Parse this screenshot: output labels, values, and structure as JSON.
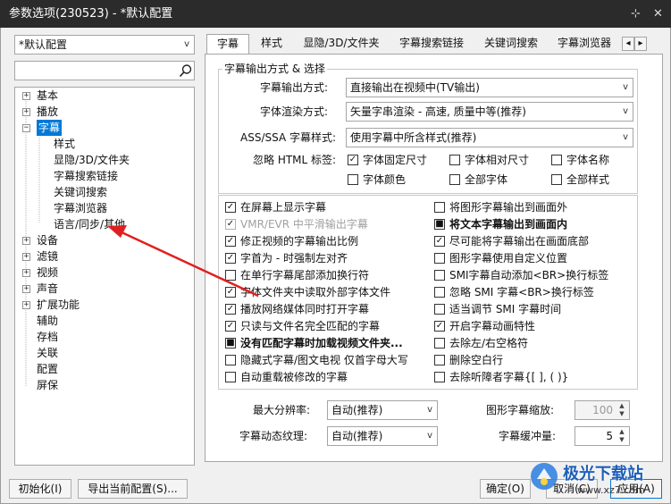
{
  "window": {
    "title": "参数选项(230523) - *默认配置",
    "pin": "⊹",
    "close": "✕"
  },
  "profile_select": {
    "value": "*默认配置"
  },
  "search": {
    "placeholder": ""
  },
  "tree": {
    "items": [
      {
        "label": "基本",
        "expander": "+"
      },
      {
        "label": "播放",
        "expander": "+"
      },
      {
        "label": "字幕",
        "expander": "−"
      },
      {
        "label": "样式"
      },
      {
        "label": "显隐/3D/文件夹"
      },
      {
        "label": "字幕搜索链接"
      },
      {
        "label": "关键词搜索"
      },
      {
        "label": "字幕浏览器"
      },
      {
        "label": "语言/同步/其他"
      },
      {
        "label": "设备",
        "expander": "+"
      },
      {
        "label": "滤镜",
        "expander": "+"
      },
      {
        "label": "视频",
        "expander": "+"
      },
      {
        "label": "声音",
        "expander": "+"
      },
      {
        "label": "扩展功能",
        "expander": "+"
      },
      {
        "label": "辅助"
      },
      {
        "label": "存档"
      },
      {
        "label": "关联"
      },
      {
        "label": "配置"
      },
      {
        "label": "屏保"
      }
    ]
  },
  "tabs": [
    {
      "label": "字幕"
    },
    {
      "label": "样式"
    },
    {
      "label": "显隐/3D/文件夹"
    },
    {
      "label": "字幕搜索链接"
    },
    {
      "label": "关键词搜索"
    },
    {
      "label": "字幕浏览器"
    }
  ],
  "tab_scroll": {
    "left": "◂",
    "right": "▸"
  },
  "output_group": {
    "title": "字幕输出方式 & 选择",
    "output_mode_label": "字幕输出方式:",
    "output_mode_value": "直接输出在视频中(TV输出)",
    "render_label": "字体渲染方式:",
    "render_value": "矢量字串渲染 - 高速, 质量中等(推荐)",
    "ass_label": "ASS/SSA 字幕样式:",
    "ass_value": "使用字幕中所含样式(推荐)",
    "html_label": "忽略 HTML 标签:",
    "html_options": [
      {
        "label": "字体固定尺寸",
        "checked": true
      },
      {
        "label": "字体相对尺寸",
        "checked": false
      },
      {
        "label": "字体名称",
        "checked": false
      },
      {
        "label": "字体颜色",
        "checked": false
      },
      {
        "label": "全部字体",
        "checked": false
      },
      {
        "label": "全部样式",
        "checked": false
      }
    ]
  },
  "options_left": [
    {
      "label": "在屏幕上显示字幕",
      "state": "checked"
    },
    {
      "label": "VMR/EVR 中平滑输出字幕",
      "state": "disabled"
    },
    {
      "label": "修正视频的字幕输出比例",
      "state": "checked"
    },
    {
      "label": "字首为 - 时强制左对齐",
      "state": "checked"
    },
    {
      "label": "在单行字幕尾部添加换行符",
      "state": "unchecked"
    },
    {
      "label": "字体文件夹中读取外部字体文件",
      "state": "checked"
    },
    {
      "label": "播放网络媒体同时打开字幕",
      "state": "checked"
    },
    {
      "label": "只读与文件名完全匹配的字幕",
      "state": "checked"
    },
    {
      "label": "没有匹配字幕时加载视频文件夹...",
      "state": "indeterminate",
      "bold": true
    },
    {
      "label": "隐藏式字幕/图文电视 仅首字母大写",
      "state": "unchecked"
    },
    {
      "label": "自动重载被修改的字幕",
      "state": "unchecked"
    }
  ],
  "options_right": [
    {
      "label": "将图形字幕输出到画面外",
      "state": "unchecked"
    },
    {
      "label": "将文本字幕输出到画面内",
      "state": "indeterminate",
      "bold": true
    },
    {
      "label": "尽可能将字幕输出在画面底部",
      "state": "checked"
    },
    {
      "label": "图形字幕使用自定义位置",
      "state": "unchecked"
    },
    {
      "label": "SMI字幕自动添加<BR>换行标签",
      "state": "unchecked"
    },
    {
      "label": "忽略 SMI 字幕<BR>换行标签",
      "state": "unchecked"
    },
    {
      "label": "适当调节 SMI 字幕时间",
      "state": "unchecked"
    },
    {
      "label": "开启字幕动画特性",
      "state": "checked"
    },
    {
      "label": "去除左/右空格符",
      "state": "unchecked"
    },
    {
      "label": "删除空白行",
      "state": "unchecked"
    },
    {
      "label": "去除听障者字幕{[ ], ( )}",
      "state": "unchecked"
    }
  ],
  "bottom_settings": {
    "max_res_label": "最大分辨率:",
    "max_res_value": "自动(推荐)",
    "texture_label": "字幕动态纹理:",
    "texture_value": "自动(推荐)",
    "scale_label": "图形字幕缩放:",
    "scale_value": "100",
    "buffer_label": "字幕缓冲量:",
    "buffer_value": "5"
  },
  "footer": {
    "init_label": "初始化(I)",
    "export_label": "导出当前配置(S)...",
    "ok_label": "确定(O)",
    "cancel_label": "取消(C)",
    "apply_label": "应用(A)"
  },
  "annotation": {
    "arrow_color": "#e02020",
    "target": "语言/同步/其他"
  },
  "watermark": {
    "text": "极光下载站",
    "url": "www.xz7.com"
  },
  "colors": {
    "selection": "#0078d7",
    "titlebar": "#2b2b2b",
    "arrow": "#e02020"
  }
}
